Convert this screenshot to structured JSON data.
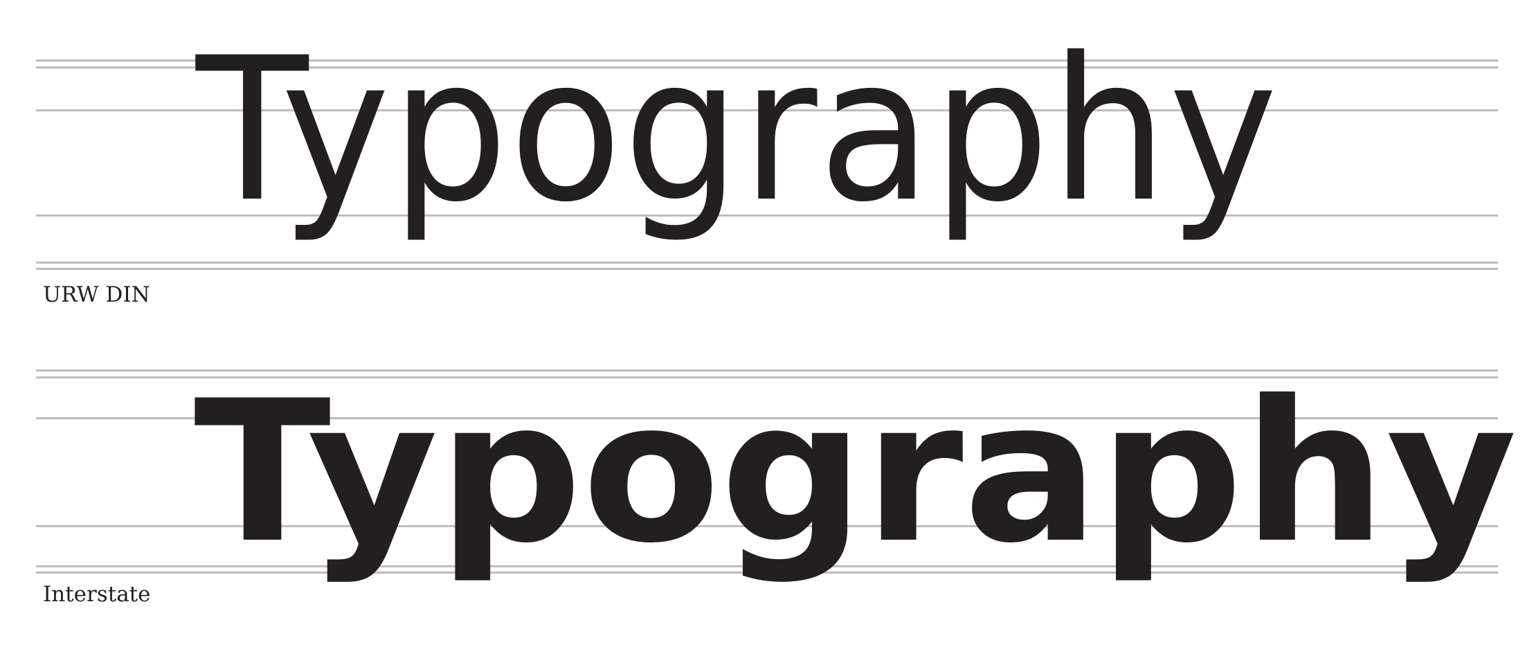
{
  "colors": {
    "text": "#231f20",
    "guideline": "#bdbdbd",
    "background": "#ffffff"
  },
  "specimens": [
    {
      "word": "Typography",
      "font_label": "URW DIN"
    },
    {
      "word": "Typography",
      "font_label": "Interstate"
    }
  ]
}
